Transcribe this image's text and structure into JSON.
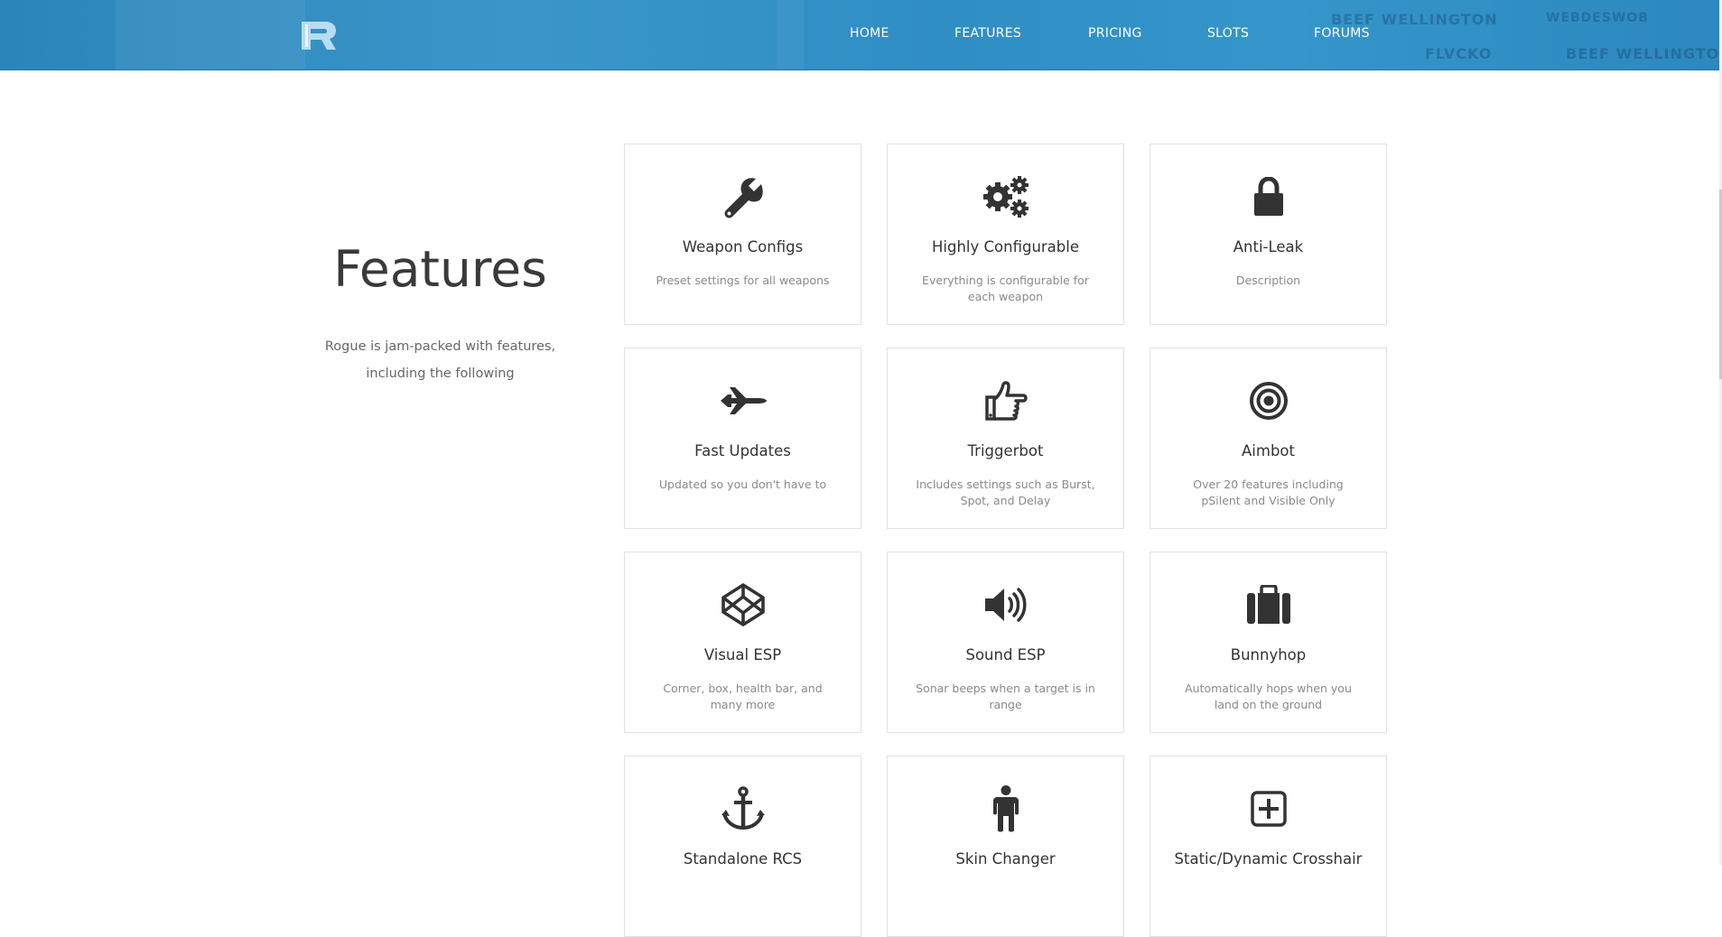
{
  "nav": {
    "links": [
      "HOME",
      "FEATURES",
      "PRICING",
      "SLOTS",
      "FORUMS"
    ],
    "watermark_lines": [
      "BEEF WELLINGTON",
      "WEBDESWOB",
      "FLVCKO",
      "BEEF WELLINGTON"
    ]
  },
  "intro": {
    "title": "Features",
    "text": "Rogue is jam-packed with features, including the following"
  },
  "features": [
    {
      "title": "Weapon Configs",
      "desc": "Preset settings for all weapons",
      "icon": "wrench-icon"
    },
    {
      "title": "Highly Configurable",
      "desc": "Everything is configurable for each weapon",
      "icon": "gears-icon"
    },
    {
      "title": "Anti-Leak",
      "desc": "Description",
      "icon": "lock-icon"
    },
    {
      "title": "Fast Updates",
      "desc": "Updated so you don't have to",
      "icon": "fighter-jet-icon"
    },
    {
      "title": "Triggerbot",
      "desc": "Includes settings such as Burst, Spot, and Delay",
      "icon": "hand-pointer-icon"
    },
    {
      "title": "Aimbot",
      "desc": "Over 20 features including pSilent and Visible Only",
      "icon": "bullseye-icon"
    },
    {
      "title": "Visual ESP",
      "desc": "Corner, box, health bar, and many more",
      "icon": "codepen-icon"
    },
    {
      "title": "Sound ESP",
      "desc": "Sonar beeps when a target is in range",
      "icon": "volume-icon"
    },
    {
      "title": "Bunnyhop",
      "desc": "Automatically hops when you land on the ground",
      "icon": "suitcase-icon"
    },
    {
      "title": "Standalone RCS",
      "desc": "",
      "icon": "anchor-icon"
    },
    {
      "title": "Skin Changer",
      "desc": "",
      "icon": "male-icon"
    },
    {
      "title": "Static/Dynamic Crosshair",
      "desc": "",
      "icon": "plus-square-icon"
    }
  ],
  "colors": {
    "nav_bg": "#2f8ec4",
    "text_dark": "#333333",
    "text_muted": "#8a8a8a",
    "card_border": "#e2e2e2"
  }
}
